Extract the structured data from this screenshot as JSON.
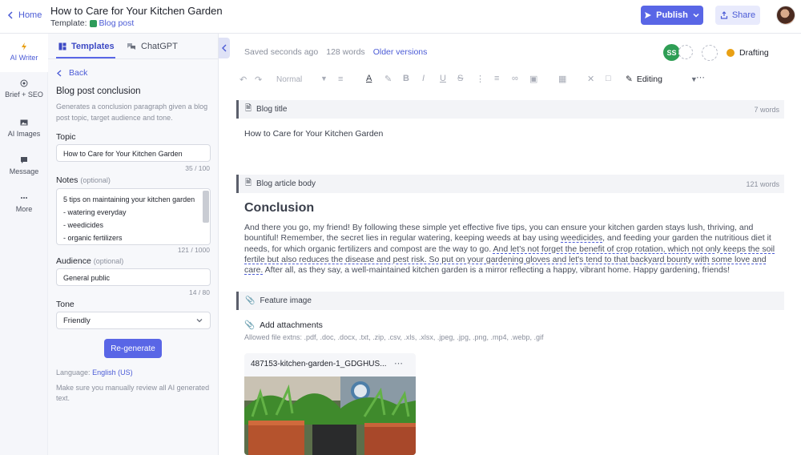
{
  "header": {
    "home_label": "Home",
    "doc_title": "How to Care for Your Kitchen Garden",
    "template_prefix": "Template:",
    "template_name": "Blog post",
    "publish_label": "Publish",
    "share_label": "Share"
  },
  "rail": {
    "items": [
      {
        "label": "AI Writer",
        "icon": "lightning-icon",
        "active": true
      },
      {
        "label": "Brief + SEO",
        "icon": "target-icon"
      },
      {
        "label": "AI Images",
        "icon": "image-icon"
      },
      {
        "label": "Message",
        "icon": "chat-icon"
      },
      {
        "label": "More",
        "icon": "ellipsis-icon"
      }
    ]
  },
  "panel": {
    "tabs": [
      {
        "label": "Templates",
        "icon": "templates-icon"
      },
      {
        "label": "ChatGPT",
        "icon": "chatgpt-icon"
      }
    ],
    "back_label": "Back",
    "heading": "Blog post conclusion",
    "description": "Generates a conclusion paragraph given a blog post topic, target audience and tone.",
    "topic": {
      "label": "Topic",
      "value": "How to Care for Your Kitchen Garden",
      "counter": "35 / 100"
    },
    "notes": {
      "label": "Notes",
      "optional": "(optional)",
      "lines": [
        "5 tips on maintaining your kitchen garden",
        "- watering everyday",
        "- weedicides",
        "- organic fertilizers"
      ],
      "counter": "121 / 1000"
    },
    "audience": {
      "label": "Audience",
      "optional": "(optional)",
      "value": "General public",
      "counter": "14 / 80"
    },
    "tone": {
      "label": "Tone",
      "value": "Friendly"
    },
    "regenerate_label": "Re-generate",
    "language_prefix": "Language:",
    "language_value": "English (US)",
    "review_note": "Make sure you manually review all AI generated text."
  },
  "editor": {
    "saved": "Saved seconds ago",
    "word_count": "128 words",
    "older_versions": "Older versions",
    "collaborator_initials": "SS",
    "status": "Drafting",
    "toolbar": {
      "style": "Normal",
      "mode": "Editing"
    },
    "blog_title_section": {
      "label": "Blog title",
      "count": "7 words",
      "text": "How to Care for Your Kitchen Garden"
    },
    "body_section": {
      "label": "Blog article body",
      "count": "121 words",
      "heading": "Conclusion",
      "p1": "And there you go, my friend! By following these simple yet effective five tips, you can ensure your kitchen garden stays lush, thriving, and bountiful! Remember, the secret lies in regular watering, keeping weeds at bay using ",
      "p_weedicides": "weedicides",
      "p2": ", and feeding your garden the nutritious diet it needs, for which organic fertilizers and compost are the way to go. ",
      "p_underlined": "And let's not forget the benefit of crop rotation, which not only keeps the soil fertile but also reduces the disease and pest risk. So put on your gardening gloves and let's tend to that backyard bounty with some love and care.",
      "p3": " After all, as they say, a well-maintained kitchen garden is a mirror reflecting a happy, vibrant home. Happy gardening, friends!"
    },
    "feature_image": {
      "label": "Feature image",
      "add_label": "Add attachments",
      "allowed": "Allowed file extns: .pdf, .doc, .docx, .txt, .zip, .csv, .xls, .xlsx, .jpeg, .jpg, .png, .mp4, .webp, .gif",
      "file_name": "487153-kitchen-garden-1_GDGHUS..."
    }
  },
  "colors": {
    "accent": "#5966e6",
    "status_drafting": "#e9a014",
    "collaborator": "#2f9e55"
  }
}
